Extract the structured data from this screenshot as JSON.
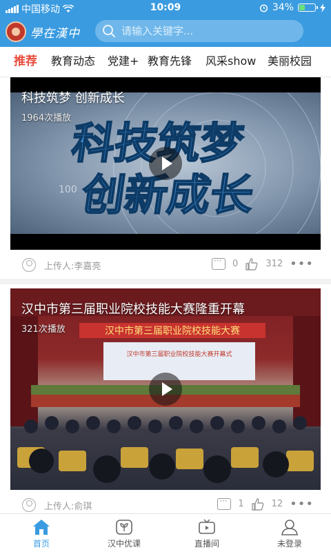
{
  "status_bar": {
    "carrier": "中国移动",
    "time": "10:09",
    "battery": "34%",
    "battery_level": 0.34
  },
  "header": {
    "logo_text": "學在漢中",
    "search_placeholder": "请输入关键字..."
  },
  "tabs": [
    {
      "label": "推荐",
      "active": true
    },
    {
      "label": "教育动态",
      "active": false
    },
    {
      "label": "党建+",
      "active": false
    },
    {
      "label": "教育先锋",
      "active": false
    },
    {
      "label": "风采show",
      "active": false
    },
    {
      "label": "美丽校园",
      "active": false
    }
  ],
  "videos": [
    {
      "title": "科技筑梦 创新成长",
      "plays": "1964次播放",
      "uploader": "上传人:李嘉亮",
      "comments": "0",
      "likes": "312",
      "poster_text_1": "科技筑梦",
      "poster_text_2": "创新成长",
      "poster_number": "100"
    },
    {
      "title": "汉中市第三届职业院校技能大赛隆重开幕",
      "plays": "321次播放",
      "uploader": "上传人:俞琪",
      "comments": "1",
      "likes": "12",
      "banner_text": "汉中市第三届职业院校技能大赛",
      "screen_text": "汉中市第三届职业院校技能大赛开幕式"
    }
  ],
  "bottom_nav": [
    {
      "label": "首页",
      "icon": "home-icon",
      "active": true
    },
    {
      "label": "汉中优课",
      "icon": "leaf-icon",
      "active": false
    },
    {
      "label": "直播间",
      "icon": "tv-icon",
      "active": false
    },
    {
      "label": "未登录",
      "icon": "user-icon",
      "active": false
    }
  ],
  "colors": {
    "primary": "#3a9be0",
    "active_tab": "#e74c3c"
  }
}
